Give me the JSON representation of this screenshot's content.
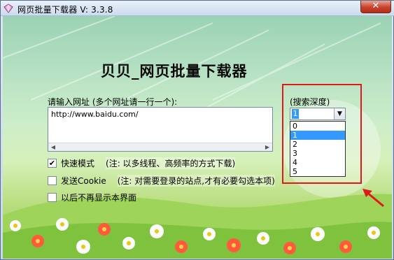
{
  "window": {
    "title": "网页批量下载器 V: 3.3.8",
    "close_label": "✕"
  },
  "main": {
    "headline": "贝贝_网页批量下载器",
    "url_label": "请输入网址 (多个网址请一行一个):",
    "url_value": "http://www.baidu.com/"
  },
  "options": [
    {
      "label": "快速模式",
      "note": "(注: 以多线程、高频率的方式下载)",
      "checked": true,
      "mark": "✔"
    },
    {
      "label": "发送Cookie",
      "note": "(注: 对需要登录的站点,才有必要勾选本项)",
      "checked": false,
      "mark": ""
    },
    {
      "label": "以后不再显示本界面",
      "note": "",
      "checked": false,
      "mark": ""
    }
  ],
  "depth": {
    "label": "(搜索深度)",
    "selected": "1",
    "options": [
      "0",
      "1",
      "2",
      "3",
      "4",
      "5"
    ],
    "highlighted_option": "1"
  },
  "colors": {
    "highlight_border": "#e0191b",
    "selection": "#3399ff"
  },
  "icons": {
    "app": "gem-icon",
    "dropdown": "chevron-down-icon",
    "close": "close-icon"
  }
}
